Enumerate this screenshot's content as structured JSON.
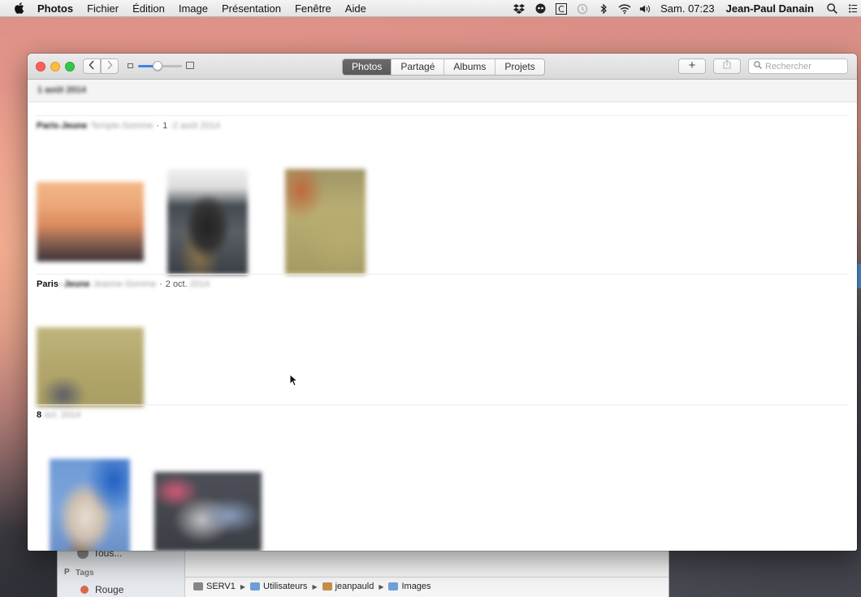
{
  "menubar": {
    "app_name": "Photos",
    "items": [
      "Fichier",
      "Édition",
      "Image",
      "Présentation",
      "Fenêtre",
      "Aide"
    ],
    "clock": "Sam. 07:23",
    "user": "Jean-Paul Danain",
    "status_icons": [
      "dropbox-icon",
      "app-indicator-icon",
      "c-icon",
      "time-machine-icon",
      "bluetooth-icon",
      "wifi-icon",
      "volume-icon"
    ]
  },
  "toolbar": {
    "tabs": [
      {
        "label": "Photos",
        "active": true
      },
      {
        "label": "Partagé",
        "active": false
      },
      {
        "label": "Albums",
        "active": false
      },
      {
        "label": "Projets",
        "active": false
      }
    ],
    "add_label": "+",
    "search_placeholder": "Rechercher",
    "zoom_level": 0.45
  },
  "content": {
    "section_header": "1 août 2014",
    "moments": [
      {
        "location": "Paris",
        "location_rest": "-Jeune",
        "sublocation": "Temple-Somme",
        "date": "1",
        "date_rest": "-2 août 2014"
      },
      {
        "location": "Paris",
        "location_rest": " - Jeune",
        "sublocation": "Jeanne-Somme",
        "date": "2 oct.",
        "date_rest": "2014"
      },
      {
        "location": "8",
        "location_rest": "",
        "sublocation": "",
        "date": "",
        "date_rest": "oct. 2014"
      }
    ]
  },
  "finder": {
    "sidebar_all": "Tous...",
    "sidebar_tags_header": "Tags",
    "sidebar_tag_rouge": "Rouge",
    "sidebar_letter": "P",
    "path": [
      "SERV1",
      "Utilisateurs",
      "jeanpauld",
      "Images"
    ]
  }
}
